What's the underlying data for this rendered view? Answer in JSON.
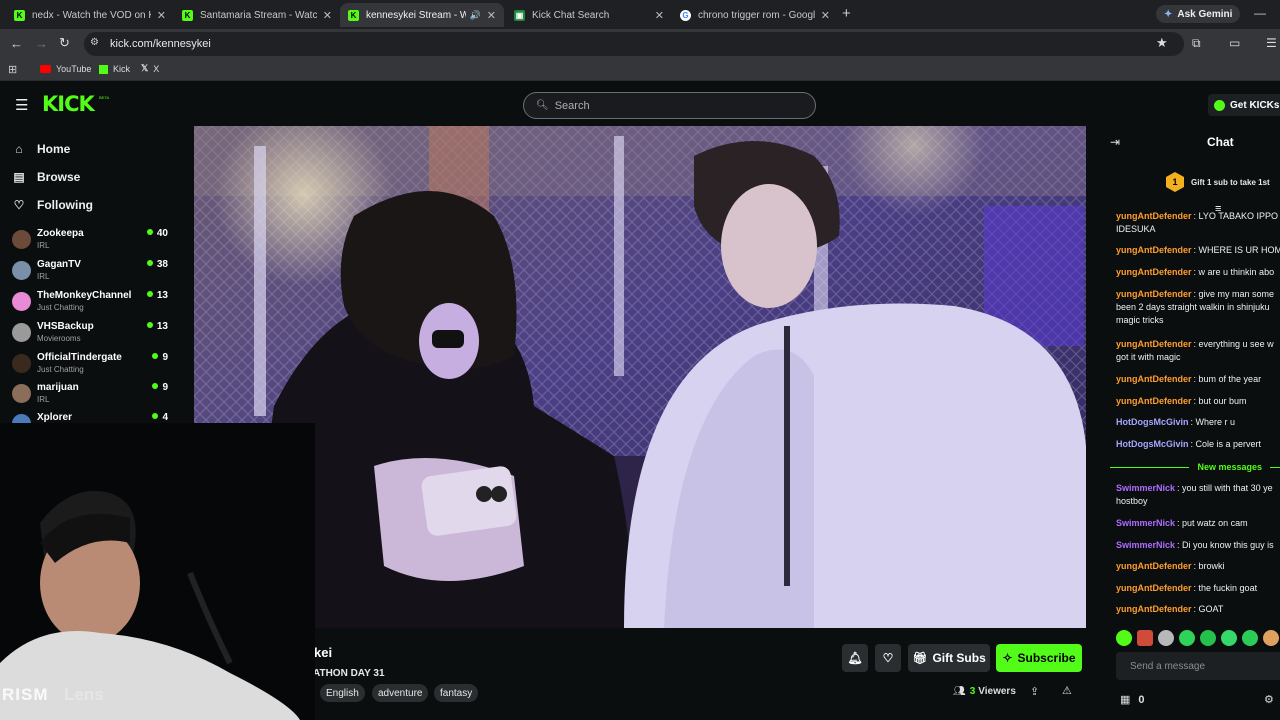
{
  "browser": {
    "tabs": [
      {
        "title": "nedx - Watch the VOD on Kick",
        "icon": "kick-favicon",
        "active": false
      },
      {
        "title": "Santamaria Stream - Watch Live",
        "icon": "kick-favicon",
        "active": false
      },
      {
        "title": "kennesykei Stream - Watch",
        "icon": "kick-favicon",
        "active": true
      },
      {
        "title": "Kick Chat Search",
        "icon": "kick-chat-favicon",
        "active": false
      },
      {
        "title": "chrono trigger rom - Google Se",
        "icon": "google-favicon",
        "active": false
      }
    ],
    "new_tab": "+",
    "ask_gemini": "Ask Gemini",
    "url": "kick.com/kennesykei",
    "bookmarks": [
      {
        "label": "YouTube",
        "icon": "youtube-icon"
      },
      {
        "label": "Kick",
        "icon": "kick-icon"
      },
      {
        "label": "X",
        "icon": "x-icon"
      }
    ]
  },
  "kick": {
    "logo": "KICK",
    "logo_badge": "BETA",
    "search_placeholder": "Search",
    "get_kicks": "Get KICKs",
    "accent": "#53fc18"
  },
  "sidebar": {
    "nav": [
      {
        "label": "Home",
        "icon": "home-icon"
      },
      {
        "label": "Browse",
        "icon": "browse-icon"
      },
      {
        "label": "Following",
        "icon": "heart-icon"
      }
    ],
    "channels": [
      {
        "name": "Zookeepa",
        "category": "IRL",
        "viewers": "40"
      },
      {
        "name": "GaganTV",
        "category": "IRL",
        "viewers": "38"
      },
      {
        "name": "TheMonkeyChannel",
        "category": "Just Chatting",
        "viewers": "13"
      },
      {
        "name": "VHSBackup",
        "category": "Movierooms",
        "viewers": "13"
      },
      {
        "name": "OfficialTindergate",
        "category": "Just Chatting",
        "viewers": "9"
      },
      {
        "name": "marijuan",
        "category": "IRL",
        "viewers": "9"
      },
      {
        "name": "Xplorer",
        "category": "",
        "viewers": "4"
      }
    ]
  },
  "stream": {
    "channel_name_visible": "kei",
    "title_visible": "ATHON DAY 31",
    "tags": [
      "English",
      "adventure",
      "fantasy"
    ],
    "gift_subs": "Gift Subs",
    "subscribe": "Subscribe",
    "viewers_count": "3",
    "viewers_label": "Viewers"
  },
  "webcam": {
    "watermark": "RISM",
    "watermark_faint": "Lens"
  },
  "chat": {
    "title": "Chat",
    "gift_banner": "Gift 1 sub to take 1st",
    "gift_rank": "1",
    "new_messages_divider": "New messages",
    "messages": [
      {
        "user": "yungAntDefender",
        "text": "LYO TABAKO IPPO",
        "cls": "u-yung",
        "cont": "IDESUKA"
      },
      {
        "user": "yungAntDefender",
        "text": "WHERE IS UR HOM",
        "cls": "u-yung"
      },
      {
        "user": "yungAntDefender",
        "text": "w are u thinkin abo",
        "cls": "u-yung"
      },
      {
        "user": "yungAntDefender",
        "text": "give my man some",
        "cls": "u-yung",
        "cont": "been 2 days straight walkin in shinjuku",
        "cont2": "magic tricks"
      },
      {
        "user": "yungAntDefender",
        "text": "everything u see w",
        "cls": "u-yung",
        "cont": "got it with magic"
      },
      {
        "user": "yungAntDefender",
        "text": "bum of the year",
        "cls": "u-yung"
      },
      {
        "user": "yungAntDefender",
        "text": "but our bum",
        "cls": "u-yung"
      },
      {
        "user": "HotDogsMcGivin",
        "text": "Where r u",
        "cls": "u-hot"
      },
      {
        "user": "HotDogsMcGivin",
        "text": "Cole is a pervert",
        "cls": "u-hot"
      },
      {
        "user": "SwimmerNick",
        "text": "you still with that 30 ye",
        "cls": "u-swim",
        "cont": "hostboy"
      },
      {
        "user": "SwimmerNick",
        "text": "put watz on cam",
        "cls": "u-swim"
      },
      {
        "user": "SwimmerNick",
        "text": "Di you know this guy is",
        "cls": "u-swim"
      },
      {
        "user": "yungAntDefender",
        "text": "browki",
        "cls": "u-yung"
      },
      {
        "user": "yungAntDefender",
        "text": "the fuckin goat",
        "cls": "u-yung"
      },
      {
        "user": "yungAntDefender",
        "text": "GOAT",
        "cls": "u-yung"
      }
    ],
    "send_placeholder": "Send a message",
    "kicks_balance": "0"
  }
}
